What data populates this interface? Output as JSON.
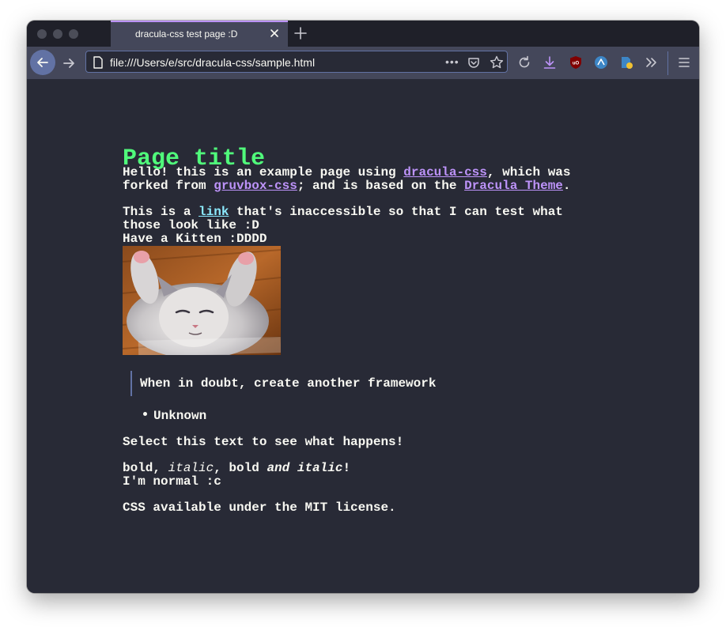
{
  "browser": {
    "tab_title": "dracula-css test page :D",
    "url": "file:///Users/e/src/dracula-css/sample.html",
    "url_more": "•••"
  },
  "toolbar_icons": [
    "back-icon",
    "forward-icon",
    "page-icon",
    "more-icon",
    "pocket-icon",
    "star-icon",
    "reload-icon",
    "download-icon",
    "ublock-icon",
    "extension-icon",
    "extension-icon",
    "overflow-icon",
    "menu-icon"
  ],
  "page": {
    "title": "Page title",
    "intro_1": "Hello! this is an example page using ",
    "link_dracula_css": "dracula-css",
    "intro_2": ", which was forked from ",
    "link_gruvbox_css": "gruvbox-css",
    "intro_3": "; and is based on the ",
    "link_dracula_theme": "Dracula Theme",
    "intro_4": ".",
    "para2_1": "This is a ",
    "para2_link": "link",
    "para2_2": " that's inaccessible so that I can test what those look like :D",
    "kitten_caption": "Have a Kitten :DDDD",
    "blockquote": "When in doubt, create another framework",
    "list_items": [
      "Unknown"
    ],
    "select_text": "Select this text to see what happens!",
    "fmt_bold": "bold",
    "fmt_sep1": ", ",
    "fmt_italic": "italic",
    "fmt_sep2": ", ",
    "fmt_bold2": "bold ",
    "fmt_bold_italic": "and italic",
    "fmt_end": "!",
    "normal_line": "I'm normal :c",
    "license": "CSS available under the MIT license."
  },
  "colors": {
    "background": "#282a36",
    "foreground": "#f8f8f2",
    "green": "#50fa7b",
    "purple": "#bd93f9",
    "cyan": "#8be9fd",
    "comment": "#6272a4",
    "current_line": "#44475a"
  }
}
